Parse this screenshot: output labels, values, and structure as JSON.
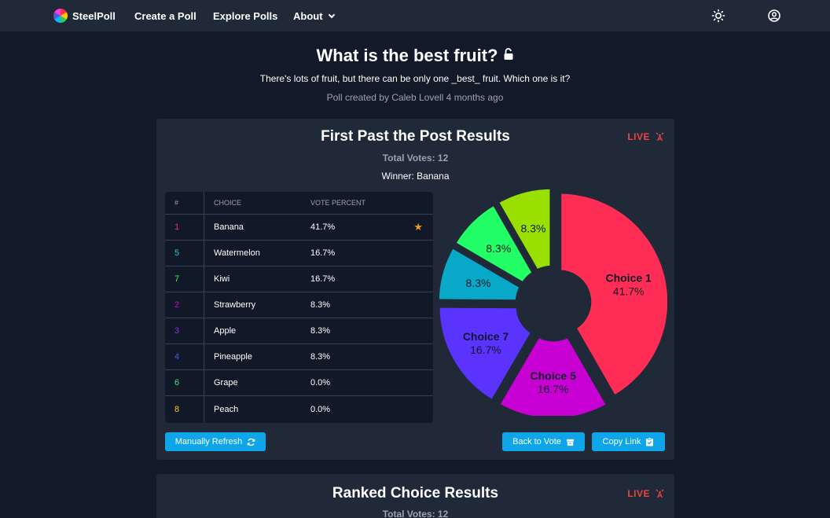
{
  "nav": {
    "brand": "SteelPoll",
    "links": [
      "Create a Poll",
      "Explore Polls",
      "About"
    ]
  },
  "poll": {
    "title": "What is the best fruit?",
    "description": "There's lots of fruit, but there can be only one _best_ fruit. Which one is it?",
    "meta": "Poll created by Caleb Lovell 4 months ago"
  },
  "fptp": {
    "title": "First Past the Post Results",
    "live": "LIVE",
    "total_votes": "Total Votes: 12",
    "winner": "Winner: Banana",
    "headers": [
      "#",
      "CHOICE",
      "VOTE PERCENT"
    ],
    "rows": [
      {
        "num": "1",
        "choice": "Banana",
        "pct": "41.7%",
        "color": "#ff2d55",
        "winner": true
      },
      {
        "num": "5",
        "choice": "Watermelon",
        "pct": "16.7%",
        "color": "#22c6d3"
      },
      {
        "num": "7",
        "choice": "Kiwi",
        "pct": "16.7%",
        "color": "#22ff66"
      },
      {
        "num": "2",
        "choice": "Strawberry",
        "pct": "8.3%",
        "color": "#d400d4"
      },
      {
        "num": "3",
        "choice": "Apple",
        "pct": "8.3%",
        "color": "#7c3aed"
      },
      {
        "num": "4",
        "choice": "Pineapple",
        "pct": "8.3%",
        "color": "#3b5bff"
      },
      {
        "num": "6",
        "choice": "Grape",
        "pct": "0.0%",
        "color": "#4ade80"
      },
      {
        "num": "8",
        "choice": "Peach",
        "pct": "0.0%",
        "color": "#facc15"
      }
    ],
    "buttons": {
      "refresh": "Manually Refresh",
      "back": "Back to Vote",
      "copy": "Copy Link"
    }
  },
  "ranked": {
    "title": "Ranked Choice Results",
    "live": "LIVE",
    "total_votes": "Total Votes: 12"
  },
  "chart_data": {
    "type": "pie",
    "categories": [
      "Choice 1",
      "Choice 5",
      "Choice 7",
      "",
      "",
      ""
    ],
    "values": [
      41.7,
      16.7,
      16.7,
      8.3,
      8.3,
      8.3
    ],
    "labels": [
      "41.7%",
      "16.7%",
      "16.7%",
      "8.3%",
      "8.3%",
      "8.3%"
    ],
    "colors": [
      "#ff2d55",
      "#c800d4",
      "#5b33ff",
      "#07a8c8",
      "#22ff66",
      "#99e000"
    ]
  }
}
